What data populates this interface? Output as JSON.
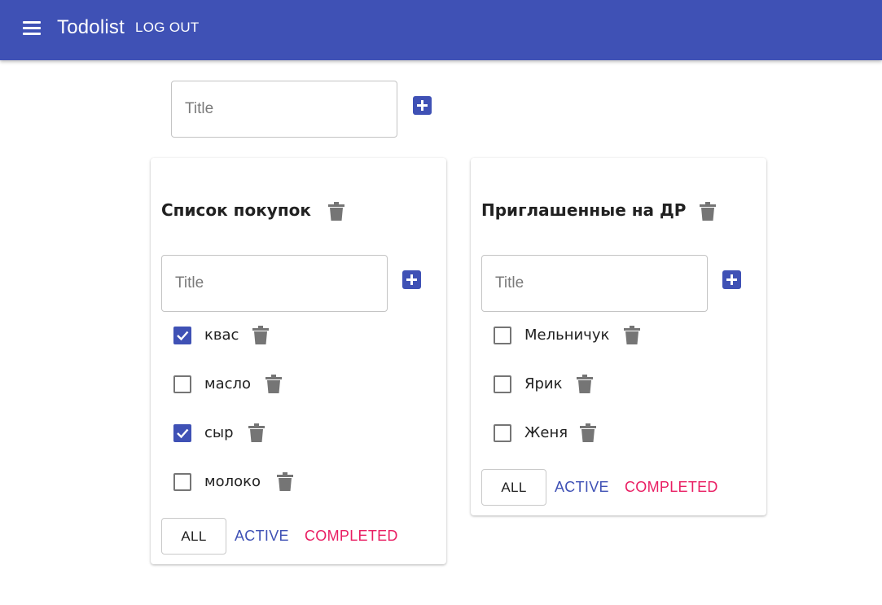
{
  "appbar": {
    "menu_icon": "menu-icon",
    "title": "Todolist",
    "logout_label": "LOG OUT",
    "color": "#3f51b5"
  },
  "new_list": {
    "placeholder": "Title",
    "add_icon": "add-box-icon"
  },
  "lists": [
    {
      "title": "Список покупок",
      "delete_icon": "trash-icon",
      "input_placeholder": "Title",
      "tasks": [
        {
          "label": "квас",
          "checked": true
        },
        {
          "label": "масло",
          "checked": false
        },
        {
          "label": "сыр",
          "checked": true
        },
        {
          "label": "молоко",
          "checked": false
        }
      ],
      "filters": {
        "all": "ALL",
        "active": "ACTIVE",
        "completed": "COMPLETED"
      }
    },
    {
      "title": "Приглашенные на ДР",
      "delete_icon": "trash-icon",
      "input_placeholder": "Title",
      "tasks": [
        {
          "label": "Мельничук",
          "checked": false
        },
        {
          "label": "Ярик",
          "checked": false
        },
        {
          "label": "Женя",
          "checked": false
        }
      ],
      "filters": {
        "all": "ALL",
        "active": "ACTIVE",
        "completed": "COMPLETED"
      }
    }
  ],
  "colors": {
    "primary": "#3f51b5",
    "secondary": "#e91e63",
    "icon_grey": "#757575"
  }
}
